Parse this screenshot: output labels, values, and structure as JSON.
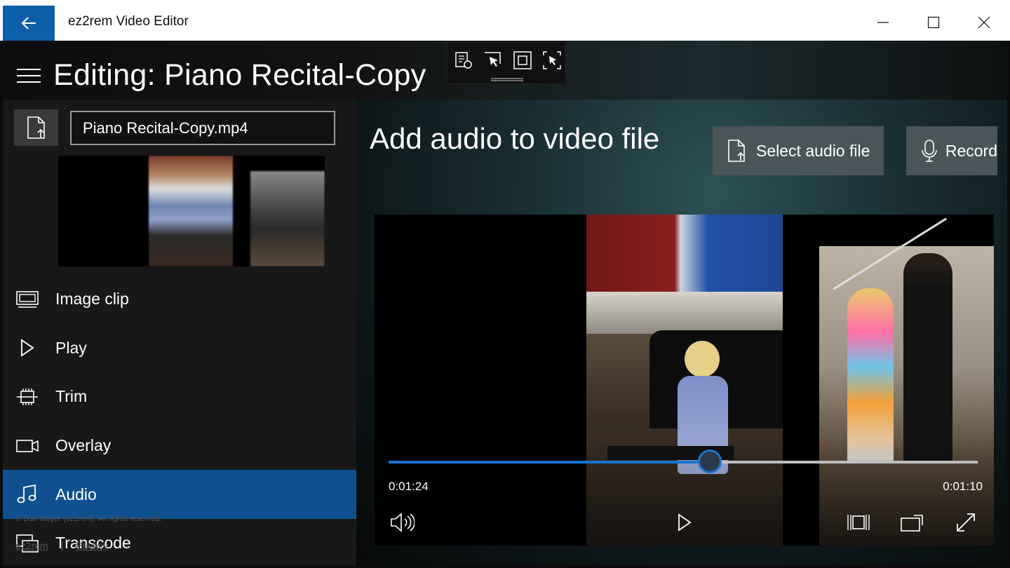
{
  "window": {
    "title": "ez2rem Video Editor",
    "accent": "#0e5fa8"
  },
  "header": {
    "title": "Editing: Piano Recital-Copy"
  },
  "sidebar": {
    "file_name": "Piano Recital-Copy.mp4",
    "items": [
      {
        "label": "Image clip",
        "icon": "image-clip-icon"
      },
      {
        "label": "Play",
        "icon": "play-icon"
      },
      {
        "label": "Trim",
        "icon": "trim-icon"
      },
      {
        "label": "Overlay",
        "icon": "camera-icon"
      },
      {
        "label": "Audio",
        "icon": "music-note-icon",
        "active": true
      },
      {
        "label": "Transcode",
        "icon": "transcode-icon"
      }
    ],
    "copyright": "© Dan Mayer (ez2rem). All rights reserved.",
    "footer_link_1": "ez2rem",
    "footer_sep": "|",
    "footer_link_2": "Privacy"
  },
  "main": {
    "title": "Add audio to video file",
    "select_audio_label": "Select audio file",
    "record_label": "Record"
  },
  "player": {
    "current_time": "0:01:24",
    "remaining_time": "0:01:10",
    "progress": 0.545,
    "progress_color": "#1a73d0"
  }
}
